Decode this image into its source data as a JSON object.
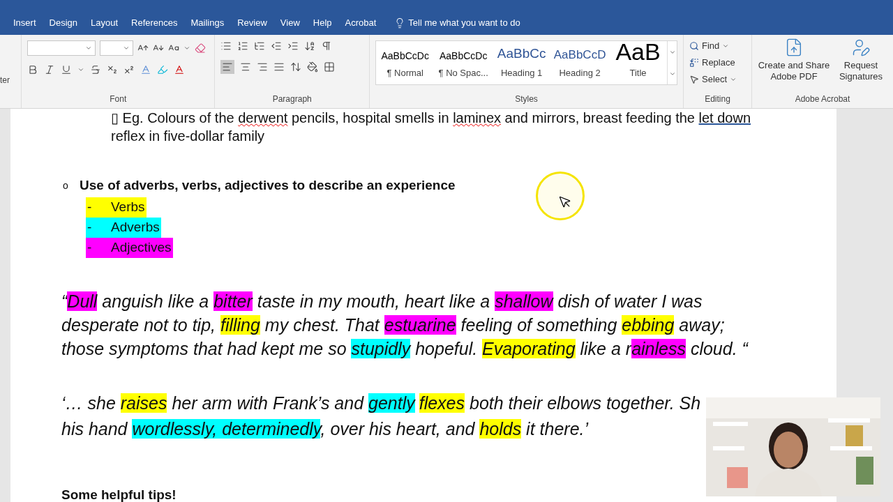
{
  "ribbon_tabs": [
    {
      "label": "Insert",
      "selected": false
    },
    {
      "label": "Design",
      "selected": false
    },
    {
      "label": "Layout",
      "selected": false
    },
    {
      "label": "References",
      "selected": false
    },
    {
      "label": "Mailings",
      "selected": false
    },
    {
      "label": "Review",
      "selected": false
    },
    {
      "label": "View",
      "selected": false
    },
    {
      "label": "Help",
      "selected": false
    },
    {
      "label": "Acrobat",
      "selected": false
    }
  ],
  "tell_me": "Tell me what you want to do",
  "ribbon": {
    "clipboard_label": "ter",
    "font_group": "Font",
    "paragraph_group": "Paragraph",
    "styles_group": "Styles",
    "editing_group": "Editing",
    "acrobat_group": "Adobe Acrobat",
    "styles": [
      {
        "kind": "normal",
        "preview": "AaBbCcDc",
        "name": "¶ Normal"
      },
      {
        "kind": "normal",
        "preview": "AaBbCcDc",
        "name": "¶ No Spac..."
      },
      {
        "kind": "heading1",
        "preview": "AaBbCc",
        "name": "Heading 1"
      },
      {
        "kind": "heading2",
        "preview": "AaBbCcD",
        "name": "Heading 2"
      },
      {
        "kind": "title",
        "preview": "AaB",
        "name": "Title"
      }
    ],
    "editing": [
      {
        "kind": "find",
        "label": "Find",
        "dropdown": true
      },
      {
        "kind": "replace",
        "label": "Replace",
        "dropdown": false
      },
      {
        "kind": "select",
        "label": "Select",
        "dropdown": true
      }
    ],
    "acrobat": [
      {
        "kind": "create",
        "label": "Create and Share Adobe PDF"
      },
      {
        "kind": "sign",
        "label": "Request Signatures"
      }
    ]
  },
  "document": {
    "example": {
      "lines": [
        [
          {
            "text": "▯ Eg. Colours of the "
          },
          {
            "text": "derwent",
            "kind": "spelling"
          },
          {
            "text": " pencils, hospital smells in "
          },
          {
            "text": "laminex",
            "kind": "spelling"
          },
          {
            "text": " and mirrors, breast feeding the "
          },
          {
            "text": "let down",
            "kind": "grammar"
          }
        ],
        [
          {
            "text": "reflex in five-dollar family"
          }
        ]
      ]
    },
    "bullet": {
      "marker": "o",
      "text": "Use of adverbs, verbs, adjectives to describe an experience"
    },
    "legend": [
      {
        "dash": "-",
        "text": "Verbs",
        "color": "#ffff00"
      },
      {
        "dash": "-",
        "text": "Adverbs",
        "color": "#00ffff"
      },
      {
        "dash": "-",
        "text": "Adjectives",
        "color": "#ff00ff"
      }
    ],
    "quotes": [
      {
        "lines": [
          [
            {
              "text": "“"
            },
            {
              "text": "Dull",
              "color": "#ff00ff"
            },
            {
              "text": " anguish like a "
            },
            {
              "text": "bitter",
              "color": "#ff00ff"
            },
            {
              "text": " taste in my mouth, heart like a "
            },
            {
              "text": "shallow",
              "color": "#ff00ff"
            },
            {
              "text": " dish of water I was"
            }
          ],
          [
            {
              "text": "desperate not to tip, "
            },
            {
              "text": "filling",
              "color": "#ffff00"
            },
            {
              "text": " my chest. That "
            },
            {
              "text": "estuarine",
              "color": "#ff00ff"
            },
            {
              "text": " feeling of something "
            },
            {
              "text": "ebbing",
              "color": "#ffff00"
            },
            {
              "text": " away;"
            }
          ],
          [
            {
              "text": "those symptoms that had kept me so "
            },
            {
              "text": "stupidly",
              "color": "#00ffff"
            },
            {
              "text": " hopeful. "
            },
            {
              "text": "Evaporating",
              "color": "#ffff00"
            },
            {
              "text": " like a r"
            },
            {
              "text": "ainless",
              "color": "#ff00ff"
            },
            {
              "text": " cloud. “"
            }
          ]
        ]
      },
      {
        "lines": [
          [
            {
              "text": " ‘… she "
            },
            {
              "text": "raises",
              "color": "#ffff00"
            },
            {
              "text": " her arm with Frank’s and "
            },
            {
              "text": "gently",
              "color": "#00ffff"
            },
            {
              "text": "flexes",
              "color": "#ffff00"
            },
            {
              "text": " both their elbows together. Sh"
            }
          ],
          [
            {
              "text": "his hand "
            },
            {
              "text": "wordlessly, determinedly",
              "color": "#00ffff"
            },
            {
              "text": ", over his heart, and "
            },
            {
              "text": "holds",
              "color": "#ffff00"
            },
            {
              "text": " it there.’"
            }
          ]
        ]
      }
    ],
    "tips_heading": "Some helpful tips!"
  }
}
